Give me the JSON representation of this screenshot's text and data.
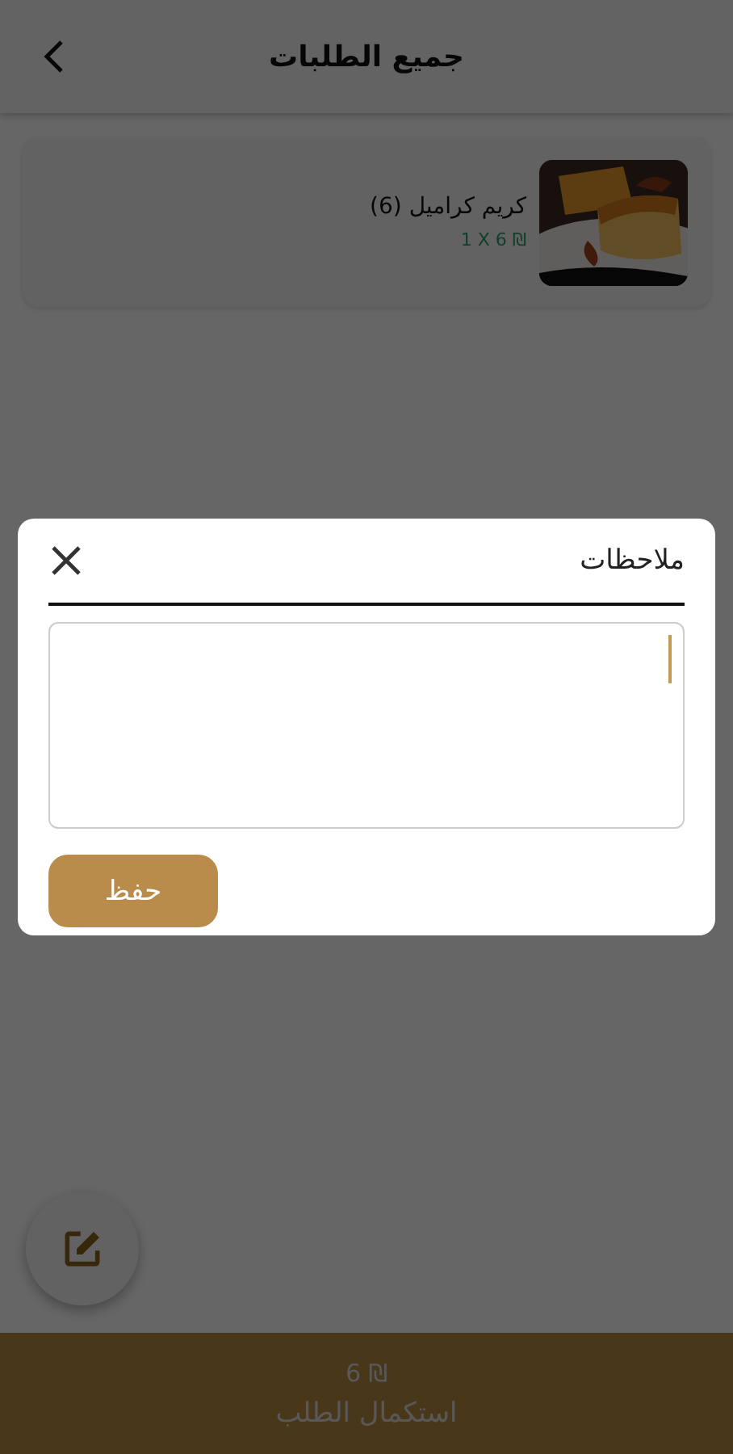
{
  "header": {
    "title": "جميع الطلبات"
  },
  "items": [
    {
      "name": "كريم كراميل (6)",
      "price": "1 X 6 ₪",
      "kind": "picture"
    }
  ],
  "notes_dialog": {
    "title": "ملاحظات",
    "field_focused": true,
    "save_button": "حفظ"
  },
  "checkout_bar": {
    "total": "6 ₪",
    "action": "استكمال الطلب"
  }
}
